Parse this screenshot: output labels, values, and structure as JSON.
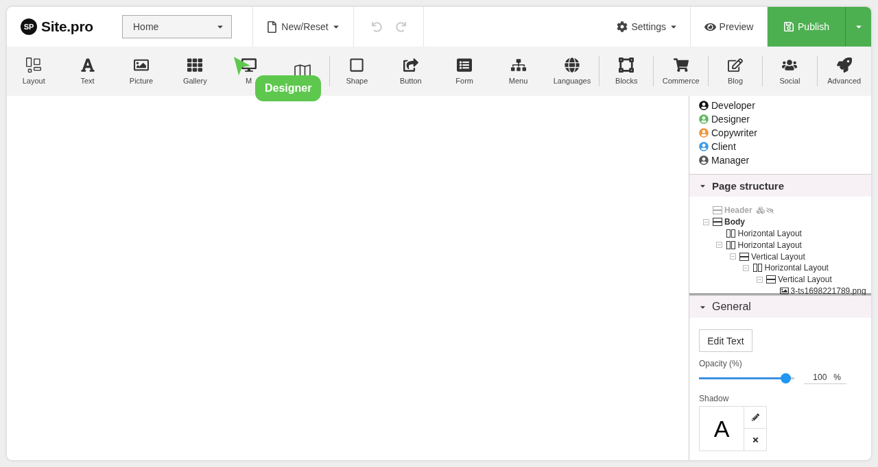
{
  "topbar": {
    "logo": {
      "badge": "SP",
      "name": "Site.pro"
    },
    "page_select": {
      "value": "Home"
    },
    "new_reset": "New/Reset",
    "settings": "Settings",
    "preview": "Preview",
    "publish": "Publish"
  },
  "tools": [
    {
      "label": "Layout"
    },
    {
      "label": "Text"
    },
    {
      "label": "Picture"
    },
    {
      "label": "Gallery"
    },
    {
      "label": "M"
    },
    {
      "kind": "icon_only"
    },
    {
      "label": "Shape",
      "separator_before": true
    },
    {
      "label": "Button"
    },
    {
      "label": "Form"
    },
    {
      "label": "Menu"
    },
    {
      "label": "Languages"
    },
    {
      "label": "Blocks",
      "separator_before": true
    },
    {
      "label": "Commerce",
      "separator_before": true
    },
    {
      "label": "Blog",
      "separator_before": true
    },
    {
      "label": "Social",
      "separator_before": true
    },
    {
      "label": "Advanced",
      "separator_before": true
    }
  ],
  "tooltip": {
    "text": "Designer"
  },
  "roles": [
    {
      "name": "Developer",
      "color": "#111111"
    },
    {
      "name": "Designer",
      "color": "#5cb85c"
    },
    {
      "name": "Copywriter",
      "color": "#f0953a"
    },
    {
      "name": "Client",
      "color": "#3d9be9"
    },
    {
      "name": "Manager",
      "color": "#555555"
    }
  ],
  "page_structure": {
    "title": "Page structure",
    "expanded": true,
    "tree": [
      {
        "label": "Header",
        "kind": "rows",
        "hidden": true
      },
      {
        "label": "Body",
        "kind": "rows",
        "hidden": false,
        "expanded": true,
        "children": [
          {
            "label": "Horizontal Layout",
            "kind": "columns",
            "hidden": false
          },
          {
            "label": "Horizontal Layout",
            "kind": "columns",
            "hidden": false,
            "expanded": true,
            "children": [
              {
                "label": "Vertical Layout",
                "kind": "rows",
                "hidden": false,
                "expanded": true,
                "children": [
                  {
                    "label": "Horizontal Layout",
                    "kind": "columns",
                    "hidden": false,
                    "expanded": true,
                    "children": [
                      {
                        "label": "Vertical Layout",
                        "kind": "rows",
                        "hidden": false,
                        "expanded": true,
                        "children": [
                          {
                            "label": "3-ts1698221789.png",
                            "kind": "image",
                            "hidden": false
                          }
                        ]
                      }
                    ]
                  }
                ]
              }
            ]
          }
        ]
      }
    ]
  },
  "general": {
    "title": "General",
    "expanded": true,
    "edit_text": "Edit Text",
    "opacity": {
      "label": "Opacity (%)",
      "level": 1.0,
      "value": "100",
      "unit": "%"
    },
    "shadow": {
      "label": "Shadow",
      "preview": "A"
    }
  }
}
